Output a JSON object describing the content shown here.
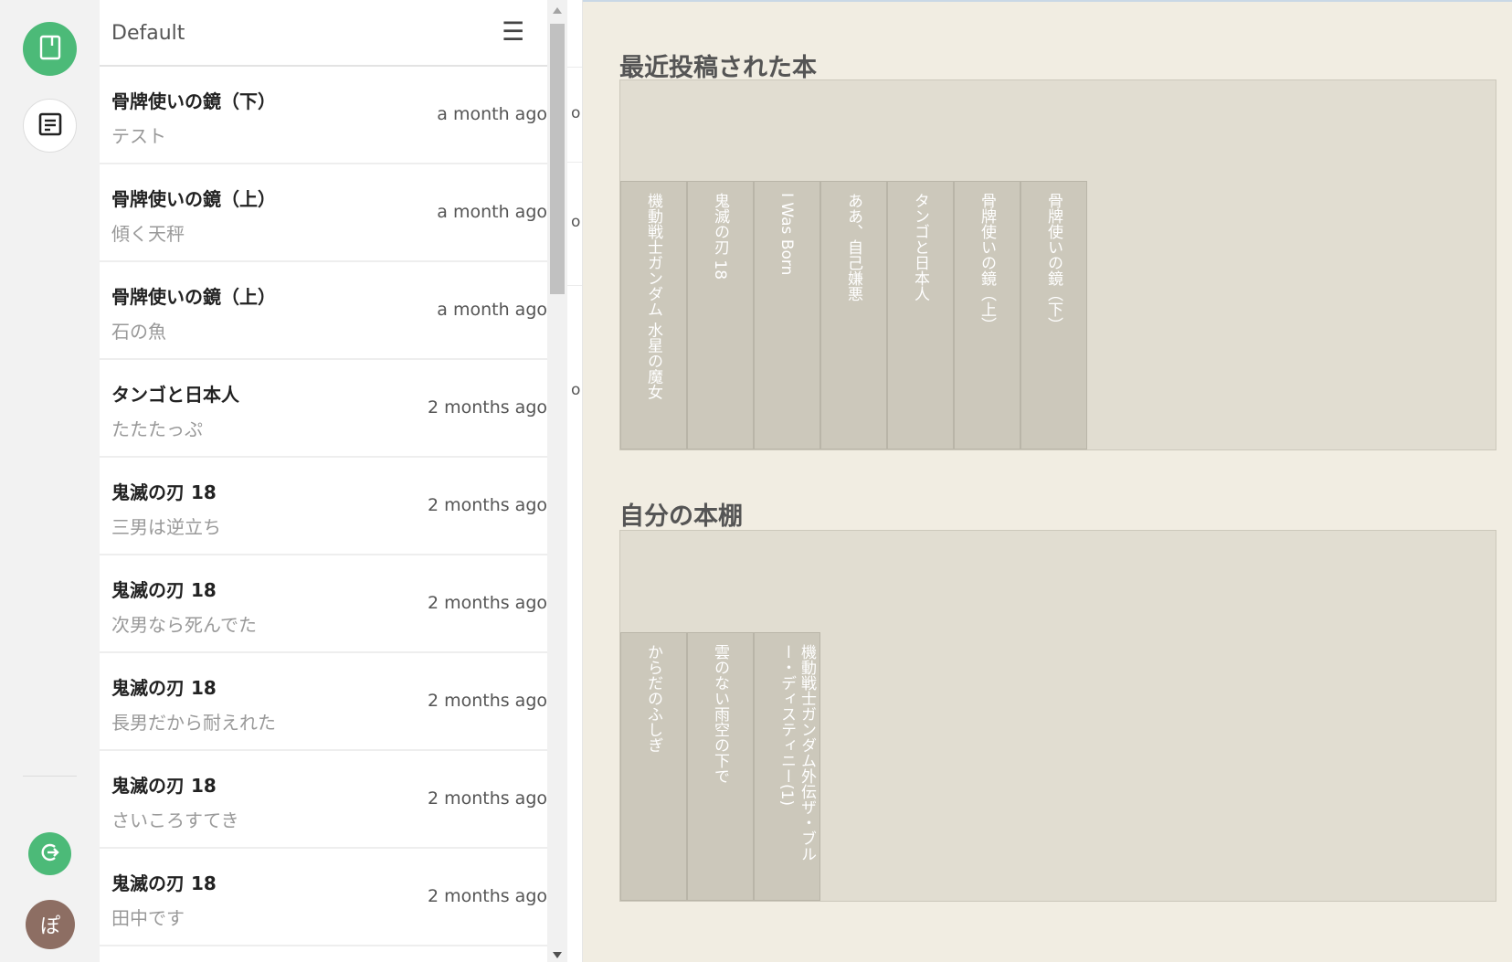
{
  "app": {
    "list_title": "Default"
  },
  "rail": {
    "books_icon": "book-icon",
    "notes_icon": "note-icon",
    "logout_icon": "logout-icon",
    "avatar_text": "ぽ",
    "accent": "#4cba78",
    "avatar_color": "#8d6e63"
  },
  "list": {
    "items": [
      {
        "title": "骨牌使いの鏡（下）",
        "subtitle": "テスト",
        "date": "a month ago"
      },
      {
        "title": "骨牌使いの鏡（上）",
        "subtitle": "傾く天秤",
        "date": "a month ago"
      },
      {
        "title": "骨牌使いの鏡（上）",
        "subtitle": "石の魚",
        "date": "a month ago"
      },
      {
        "title": "タンゴと日本人",
        "subtitle": "たたたっぷ",
        "date": "2 months ago"
      },
      {
        "title": "鬼滅の刃 18",
        "subtitle": "三男は逆立ち",
        "date": "2 months ago"
      },
      {
        "title": "鬼滅の刃 18",
        "subtitle": "次男なら死んでた",
        "date": "2 months ago"
      },
      {
        "title": "鬼滅の刃 18",
        "subtitle": "長男だから耐えれた",
        "date": "2 months ago"
      },
      {
        "title": "鬼滅の刃 18",
        "subtitle": "さいころすてき",
        "date": "2 months ago"
      },
      {
        "title": "鬼滅の刃 18",
        "subtitle": "田中です",
        "date": "2 months ago"
      }
    ]
  },
  "peek": {
    "chars": [
      "o",
      "o",
      "o"
    ]
  },
  "main": {
    "recent": {
      "title": "最近投稿された本",
      "books": [
        "機動戦士ガンダム 水星の魔女",
        "鬼滅の刃 18",
        "I Was Born",
        "ああ、自己嫌悪",
        "タンゴと日本人",
        "骨牌使いの鏡（上）",
        "骨牌使いの鏡（下）"
      ]
    },
    "mine": {
      "title": "自分の本棚",
      "books": [
        "からだのふしぎ",
        "雲のない雨空の下で",
        "機動戦士ガンダム外伝ザ・ブルー・ディスティニー(1)"
      ]
    }
  }
}
